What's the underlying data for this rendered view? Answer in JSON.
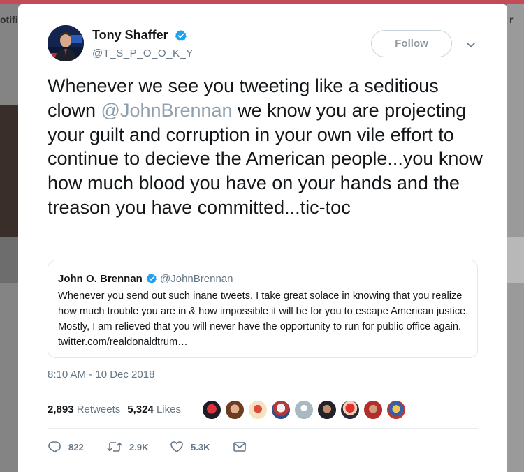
{
  "background": {
    "left_text": "otifi",
    "right_text": "r"
  },
  "author": {
    "display_name": "Tony Shaffer",
    "handle": "@T_S_P_O_O_K_Y",
    "avatar_icon": "avatar-photo"
  },
  "follow_label": "Follow",
  "tweet": {
    "before": "Whenever we see you tweeting like a seditious clown ",
    "mention": "@JohnBrennan",
    "after": " we know you are projecting your guilt and corruption in your own vile effort to continue to decieve the American people...you know how much blood you have on your hands and the treason you have committed...tic-toc",
    "timestamp": "8:10 AM - 10 Dec 2018"
  },
  "quote": {
    "name": "John O. Brennan",
    "handle": "@JohnBrennan",
    "text": "Whenever you send out such inane tweets, I take great solace in knowing that you realize how much trouble you are in & how impossible it will be for you to escape American justice. Mostly, I am relieved that you will never have the opportunity to run for public office again. twitter.com/realdonaldtrum…"
  },
  "stats": {
    "retweets_count": "2,893",
    "retweets_label": "Retweets",
    "likes_count": "5,324",
    "likes_label": "Likes"
  },
  "actions": {
    "reply_count": "822",
    "retweet_count": "2.9K",
    "like_count": "5.3K"
  },
  "colors": {
    "accent": "#1da1f2",
    "text": "#14171a",
    "muted": "#657786"
  }
}
